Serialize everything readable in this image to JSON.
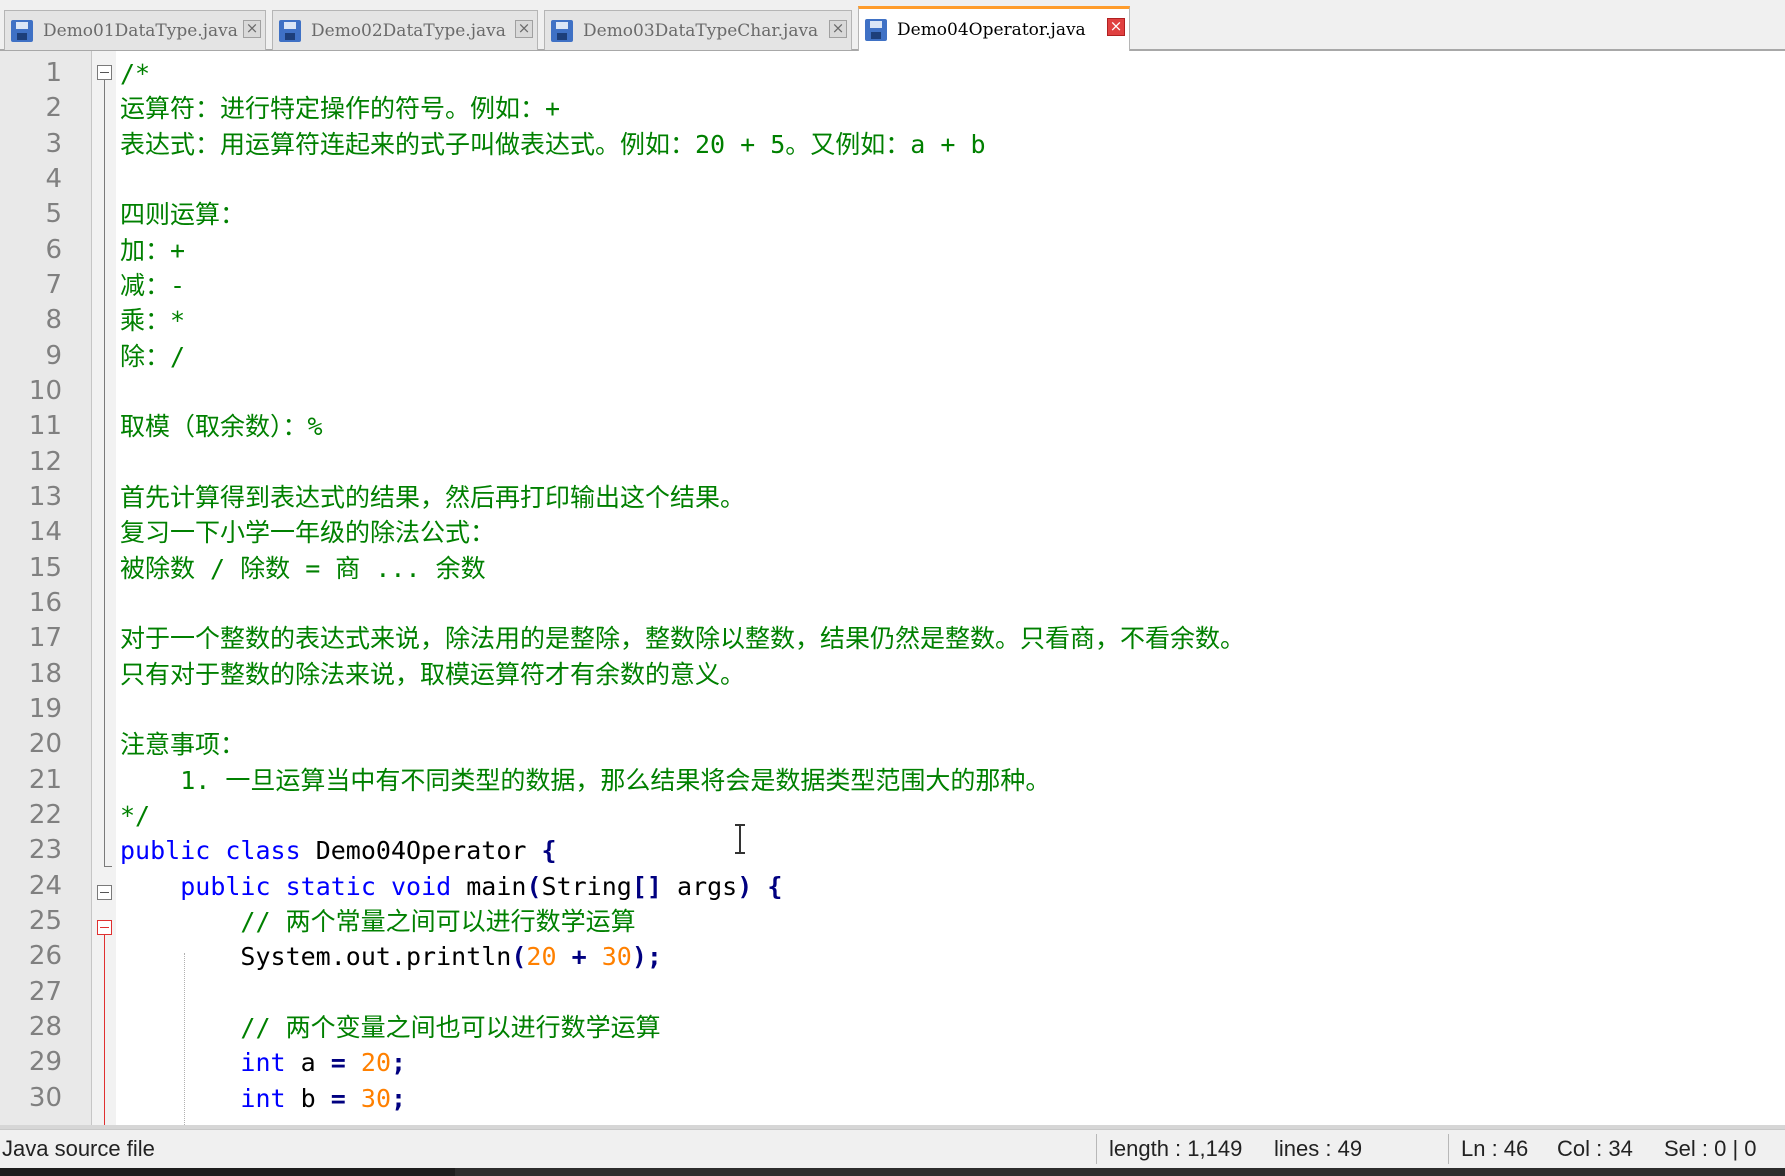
{
  "tabs": [
    {
      "label": "Demo01DataType.java",
      "active": false
    },
    {
      "label": "Demo02DataType.java",
      "active": false
    },
    {
      "label": "Demo03DataTypeChar.java",
      "active": false
    },
    {
      "label": "Demo04Operator.java",
      "active": true
    }
  ],
  "close_glyph": "×",
  "line_numbers": [
    "1",
    "2",
    "3",
    "4",
    "5",
    "6",
    "7",
    "8",
    "9",
    "10",
    "11",
    "12",
    "13",
    "14",
    "15",
    "16",
    "17",
    "18",
    "19",
    "20",
    "21",
    "22",
    "23",
    "24",
    "25",
    "26",
    "27",
    "28",
    "29",
    "30"
  ],
  "code": {
    "l1": "/*",
    "l2": "运算符：进行特定操作的符号。例如：+",
    "l3": "表达式：用运算符连起来的式子叫做表达式。例如：20 + 5。又例如：a + b",
    "l4": "",
    "l5": "四则运算：",
    "l6": "加：+",
    "l7": "减：-",
    "l8": "乘：*",
    "l9": "除：/",
    "l10": "",
    "l11": "取模（取余数）：%",
    "l12": "",
    "l13": "首先计算得到表达式的结果，然后再打印输出这个结果。",
    "l14": "复习一下小学一年级的除法公式：",
    "l15": "被除数 / 除数 = 商 ... 余数",
    "l16": "",
    "l17": "对于一个整数的表达式来说，除法用的是整除，整数除以整数，结果仍然是整数。只看商，不看余数。",
    "l18": "只有对于整数的除法来说，取模运算符才有余数的意义。",
    "l19": "",
    "l20": "注意事项：",
    "l21": "    1. 一旦运算当中有不同类型的数据，那么结果将会是数据类型范围大的那种。",
    "l22": "*/",
    "l23": {
      "kw1": "public",
      "kw2": "class",
      "name": "Demo04Operator",
      "brace": "{"
    },
    "l24": {
      "indent": "    ",
      "kw1": "public",
      "kw2": "static",
      "kw3": "void",
      "method": "main",
      "paren_open": "(",
      "type": "String",
      "brackets": "[]",
      "arg": "args",
      "paren_close": ")",
      "brace": "{"
    },
    "l25": "        // 两个常量之间可以进行数学运算",
    "l26": {
      "indent": "        ",
      "call": "System.out.println",
      "paren_open": "(",
      "n1": "20",
      "plus": "+",
      "n2": "30",
      "tail": ");"
    },
    "l27": "",
    "l28": "        // 两个变量之间也可以进行数学运算",
    "l29": {
      "indent": "        ",
      "kw": "int",
      "var": "a",
      "eq": "=",
      "val": "20",
      "semi": ";"
    },
    "l30": {
      "indent": "        ",
      "kw": "int",
      "var": "b",
      "eq": "=",
      "val": "30",
      "semi": ";"
    }
  },
  "status": {
    "file_type": "Java source file",
    "length": "length : 1,149",
    "lines": "lines : 49",
    "ln": "Ln : 46",
    "col": "Col : 34",
    "sel": "Sel : 0 | 0"
  },
  "colors": {
    "comment": "#008000",
    "keyword": "#0000ff",
    "number": "#ff8000",
    "operator": "#000080",
    "active_tab_accent": "#ff9c2b",
    "close_active": "#e04040"
  }
}
